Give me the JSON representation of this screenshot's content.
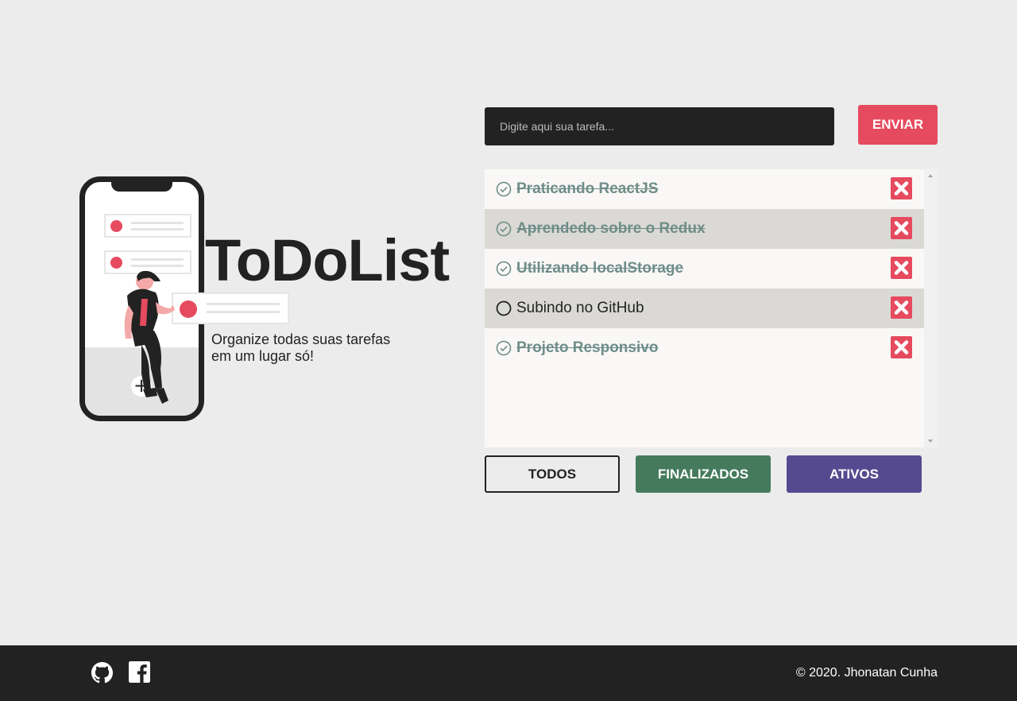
{
  "hero": {
    "title": "ToDoList",
    "subtitle_line1": "Organize todas suas tarefas",
    "subtitle_line2": "em um lugar só!"
  },
  "form": {
    "placeholder": "Digite aqui sua tarefa...",
    "submit_label": "ENVIAR"
  },
  "tasks": [
    {
      "text": "Praticando ReactJS",
      "done": true
    },
    {
      "text": "Aprendedo sobre o Redux",
      "done": true
    },
    {
      "text": "Utilizando localStorage",
      "done": true
    },
    {
      "text": "Subindo no GitHub",
      "done": false
    },
    {
      "text": "Projeto Responsivo",
      "done": true
    }
  ],
  "filters": {
    "all": "TODOS",
    "done": "FINALIZADOS",
    "active": "ATIVOS"
  },
  "footer": {
    "copyright": "© 2020. Jhonatan Cunha",
    "icons": [
      "github-icon",
      "facebook-icon"
    ]
  },
  "colors": {
    "accent": "#e64a5e",
    "dark": "#222222",
    "done_text": "#6f8d88",
    "finalizados": "#457b5c",
    "ativos": "#554a8f",
    "delete_icon": "#e64a5e"
  }
}
